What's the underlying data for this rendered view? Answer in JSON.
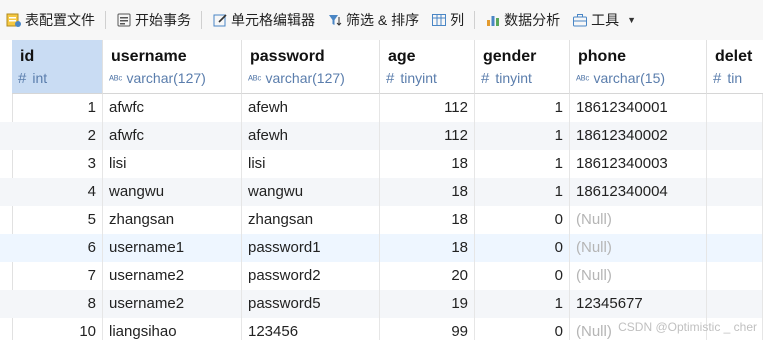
{
  "toolbar": {
    "items": [
      {
        "label": "表配置文件",
        "icon": "table-config-icon"
      },
      {
        "label": "开始事务",
        "icon": "transaction-icon"
      },
      {
        "label": "单元格编辑器",
        "icon": "edit-icon"
      },
      {
        "label": "筛选 & 排序",
        "icon": "filter-icon"
      },
      {
        "label": "列",
        "icon": "columns-icon"
      },
      {
        "label": "数据分析",
        "icon": "chart-icon"
      },
      {
        "label": "工具",
        "icon": "toolbox-icon"
      }
    ]
  },
  "columns": [
    {
      "name": "id",
      "type": "int",
      "type_icon": "#"
    },
    {
      "name": "username",
      "type": "varchar(127)",
      "type_icon": "ABC"
    },
    {
      "name": "password",
      "type": "varchar(127)",
      "type_icon": "ABC"
    },
    {
      "name": "age",
      "type": "tinyint",
      "type_icon": "#"
    },
    {
      "name": "gender",
      "type": "tinyint",
      "type_icon": "#"
    },
    {
      "name": "phone",
      "type": "varchar(15)",
      "type_icon": "ABC"
    },
    {
      "name": "delet",
      "type": "tin",
      "type_icon": "#"
    }
  ],
  "rows": [
    [
      "1",
      "afwfc",
      "afewh",
      "112",
      "1",
      "18612340001"
    ],
    [
      "2",
      "afwfc",
      "afewh",
      "112",
      "1",
      "18612340002"
    ],
    [
      "3",
      "lisi",
      "lisi",
      "18",
      "1",
      "18612340003"
    ],
    [
      "4",
      "wangwu",
      "wangwu",
      "18",
      "1",
      "18612340004"
    ],
    [
      "5",
      "zhangsan",
      "zhangsan",
      "18",
      "0",
      "(Null)"
    ],
    [
      "6",
      "username1",
      "password1",
      "18",
      "0",
      "(Null)"
    ],
    [
      "7",
      "username2",
      "password2",
      "20",
      "0",
      "(Null)"
    ],
    [
      "8",
      "username2",
      "password5",
      "19",
      "1",
      "12345677"
    ],
    [
      "10",
      "liangsihao",
      "123456",
      "99",
      "0",
      "(Null)"
    ]
  ],
  "watermark": "CSDN @Optimistic _ cher",
  "colors": {
    "selected_header": "#c9dcf3",
    "type_text": "#5a7dac",
    "null_text": "#b5b5b5"
  }
}
